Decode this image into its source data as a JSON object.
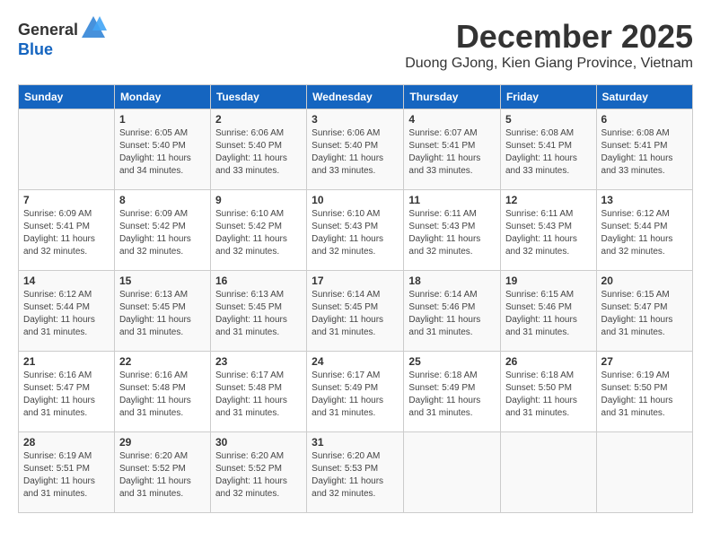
{
  "header": {
    "logo_general": "General",
    "logo_blue": "Blue",
    "month_title": "December 2025",
    "location": "Duong GJong, Kien Giang Province, Vietnam"
  },
  "days_of_week": [
    "Sunday",
    "Monday",
    "Tuesday",
    "Wednesday",
    "Thursday",
    "Friday",
    "Saturday"
  ],
  "weeks": [
    [
      {
        "day": "",
        "info": ""
      },
      {
        "day": "1",
        "info": "Sunrise: 6:05 AM\nSunset: 5:40 PM\nDaylight: 11 hours\nand 34 minutes."
      },
      {
        "day": "2",
        "info": "Sunrise: 6:06 AM\nSunset: 5:40 PM\nDaylight: 11 hours\nand 33 minutes."
      },
      {
        "day": "3",
        "info": "Sunrise: 6:06 AM\nSunset: 5:40 PM\nDaylight: 11 hours\nand 33 minutes."
      },
      {
        "day": "4",
        "info": "Sunrise: 6:07 AM\nSunset: 5:41 PM\nDaylight: 11 hours\nand 33 minutes."
      },
      {
        "day": "5",
        "info": "Sunrise: 6:08 AM\nSunset: 5:41 PM\nDaylight: 11 hours\nand 33 minutes."
      },
      {
        "day": "6",
        "info": "Sunrise: 6:08 AM\nSunset: 5:41 PM\nDaylight: 11 hours\nand 33 minutes."
      }
    ],
    [
      {
        "day": "7",
        "info": "Sunrise: 6:09 AM\nSunset: 5:41 PM\nDaylight: 11 hours\nand 32 minutes."
      },
      {
        "day": "8",
        "info": "Sunrise: 6:09 AM\nSunset: 5:42 PM\nDaylight: 11 hours\nand 32 minutes."
      },
      {
        "day": "9",
        "info": "Sunrise: 6:10 AM\nSunset: 5:42 PM\nDaylight: 11 hours\nand 32 minutes."
      },
      {
        "day": "10",
        "info": "Sunrise: 6:10 AM\nSunset: 5:43 PM\nDaylight: 11 hours\nand 32 minutes."
      },
      {
        "day": "11",
        "info": "Sunrise: 6:11 AM\nSunset: 5:43 PM\nDaylight: 11 hours\nand 32 minutes."
      },
      {
        "day": "12",
        "info": "Sunrise: 6:11 AM\nSunset: 5:43 PM\nDaylight: 11 hours\nand 32 minutes."
      },
      {
        "day": "13",
        "info": "Sunrise: 6:12 AM\nSunset: 5:44 PM\nDaylight: 11 hours\nand 32 minutes."
      }
    ],
    [
      {
        "day": "14",
        "info": "Sunrise: 6:12 AM\nSunset: 5:44 PM\nDaylight: 11 hours\nand 31 minutes."
      },
      {
        "day": "15",
        "info": "Sunrise: 6:13 AM\nSunset: 5:45 PM\nDaylight: 11 hours\nand 31 minutes."
      },
      {
        "day": "16",
        "info": "Sunrise: 6:13 AM\nSunset: 5:45 PM\nDaylight: 11 hours\nand 31 minutes."
      },
      {
        "day": "17",
        "info": "Sunrise: 6:14 AM\nSunset: 5:45 PM\nDaylight: 11 hours\nand 31 minutes."
      },
      {
        "day": "18",
        "info": "Sunrise: 6:14 AM\nSunset: 5:46 PM\nDaylight: 11 hours\nand 31 minutes."
      },
      {
        "day": "19",
        "info": "Sunrise: 6:15 AM\nSunset: 5:46 PM\nDaylight: 11 hours\nand 31 minutes."
      },
      {
        "day": "20",
        "info": "Sunrise: 6:15 AM\nSunset: 5:47 PM\nDaylight: 11 hours\nand 31 minutes."
      }
    ],
    [
      {
        "day": "21",
        "info": "Sunrise: 6:16 AM\nSunset: 5:47 PM\nDaylight: 11 hours\nand 31 minutes."
      },
      {
        "day": "22",
        "info": "Sunrise: 6:16 AM\nSunset: 5:48 PM\nDaylight: 11 hours\nand 31 minutes."
      },
      {
        "day": "23",
        "info": "Sunrise: 6:17 AM\nSunset: 5:48 PM\nDaylight: 11 hours\nand 31 minutes."
      },
      {
        "day": "24",
        "info": "Sunrise: 6:17 AM\nSunset: 5:49 PM\nDaylight: 11 hours\nand 31 minutes."
      },
      {
        "day": "25",
        "info": "Sunrise: 6:18 AM\nSunset: 5:49 PM\nDaylight: 11 hours\nand 31 minutes."
      },
      {
        "day": "26",
        "info": "Sunrise: 6:18 AM\nSunset: 5:50 PM\nDaylight: 11 hours\nand 31 minutes."
      },
      {
        "day": "27",
        "info": "Sunrise: 6:19 AM\nSunset: 5:50 PM\nDaylight: 11 hours\nand 31 minutes."
      }
    ],
    [
      {
        "day": "28",
        "info": "Sunrise: 6:19 AM\nSunset: 5:51 PM\nDaylight: 11 hours\nand 31 minutes."
      },
      {
        "day": "29",
        "info": "Sunrise: 6:20 AM\nSunset: 5:52 PM\nDaylight: 11 hours\nand 31 minutes."
      },
      {
        "day": "30",
        "info": "Sunrise: 6:20 AM\nSunset: 5:52 PM\nDaylight: 11 hours\nand 32 minutes."
      },
      {
        "day": "31",
        "info": "Sunrise: 6:20 AM\nSunset: 5:53 PM\nDaylight: 11 hours\nand 32 minutes."
      },
      {
        "day": "",
        "info": ""
      },
      {
        "day": "",
        "info": ""
      },
      {
        "day": "",
        "info": ""
      }
    ]
  ]
}
